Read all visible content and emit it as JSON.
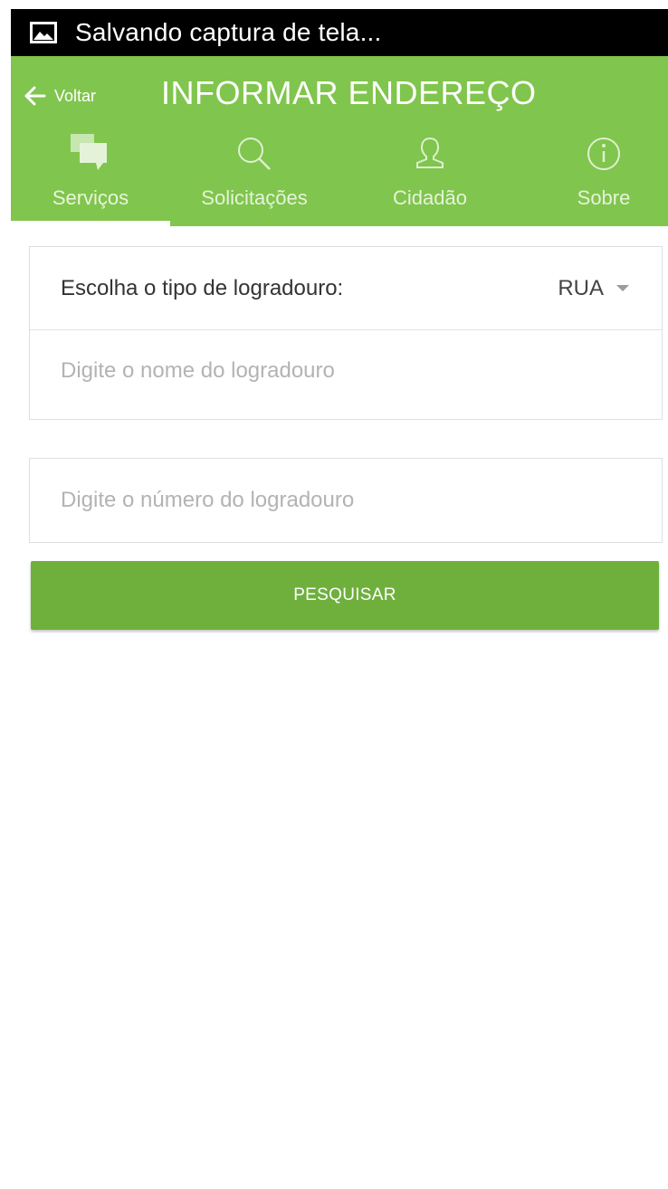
{
  "status_bar": {
    "notification_text": "Salvando captura de tela...",
    "icon": "image-icon"
  },
  "header": {
    "back_label": "Voltar",
    "title": "INFORMAR ENDEREÇO",
    "background_color": "#80c54d"
  },
  "tabs": [
    {
      "label": "Serviços",
      "icon": "chat-bubbles-icon",
      "active": true
    },
    {
      "label": "Solicitações",
      "icon": "search-icon",
      "active": false
    },
    {
      "label": "Cidadão",
      "icon": "person-icon",
      "active": false
    },
    {
      "label": "Sobre",
      "icon": "info-icon",
      "active": false
    }
  ],
  "form": {
    "type_label": "Escolha o tipo de logradouro:",
    "type_selected": "RUA",
    "name_placeholder": "Digite o nome do logradouro",
    "name_value": "",
    "number_placeholder": "Digite o número do logradouro",
    "number_value": ""
  },
  "search_button": {
    "label": "PESQUISAR",
    "color": "#6fb03d"
  }
}
